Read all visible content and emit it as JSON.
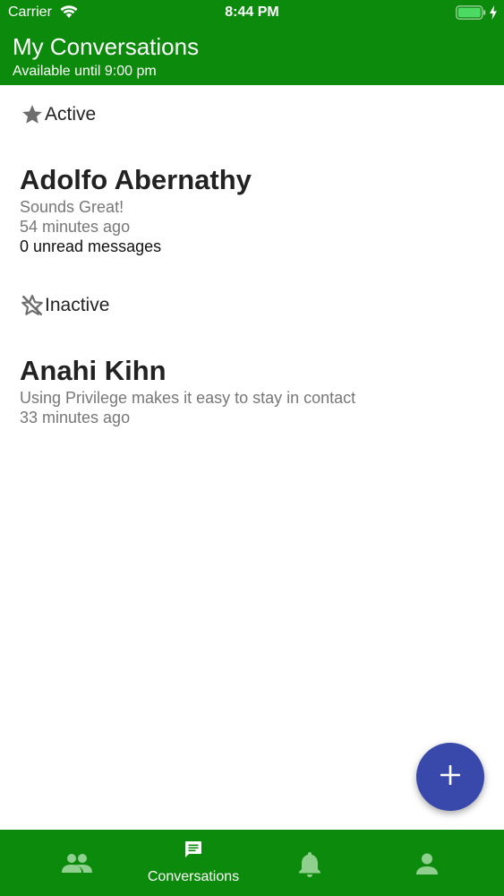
{
  "status_bar": {
    "carrier": "Carrier",
    "time": "8:44 PM"
  },
  "header": {
    "title": "My Conversations",
    "subtitle": "Available until 9:00 pm"
  },
  "sections": {
    "active": {
      "label": "Active",
      "icon": "star-icon",
      "conversation": {
        "name": "Adolfo Abernathy",
        "last_message": "Sounds Great!",
        "time_ago": "54 minutes ago",
        "unread": "0 unread messages"
      }
    },
    "inactive": {
      "label": "Inactive",
      "icon": "star-off-icon",
      "conversation": {
        "name": "Anahi Kihn",
        "last_message": "Using Privilege makes it easy to stay in contact",
        "time_ago": "33 minutes ago"
      }
    }
  },
  "fab": {
    "icon": "plus-icon"
  },
  "tab_bar": {
    "tabs": [
      {
        "icon": "people-icon",
        "label": ""
      },
      {
        "icon": "chat-icon",
        "label": "Conversations",
        "selected": true
      },
      {
        "icon": "bell-icon",
        "label": ""
      },
      {
        "icon": "person-icon",
        "label": ""
      }
    ]
  },
  "colors": {
    "brand_green": "#0b8a0b",
    "fab_blue": "#3949ab",
    "inactive_tab_icon": "#8fd08f"
  }
}
